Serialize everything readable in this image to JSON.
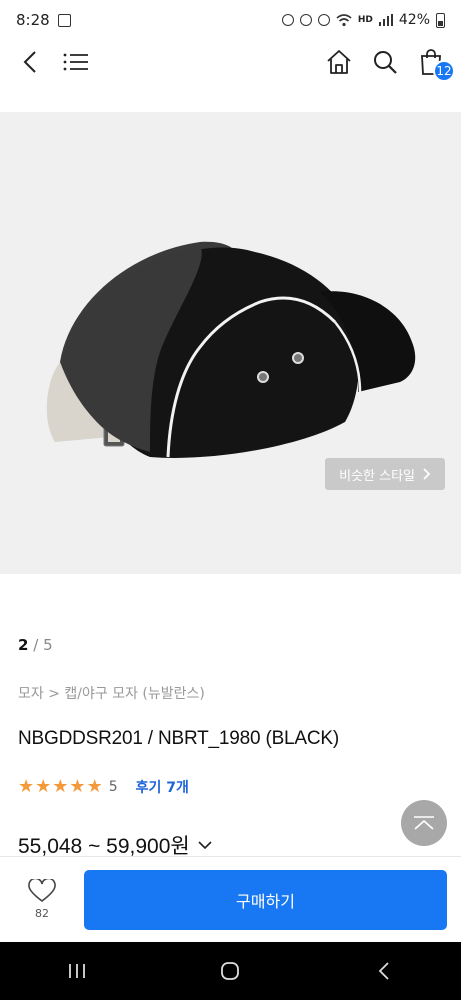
{
  "status": {
    "time": "8:28",
    "network": "HD",
    "battery": "42%"
  },
  "nav": {
    "cart_count": "12",
    "icons": [
      "back-icon",
      "menu-icon",
      "home-icon",
      "search-icon",
      "cart-icon"
    ]
  },
  "gallery": {
    "similar_style_label": "비슷한 스타일",
    "current": "2",
    "separator": "/",
    "total": "5"
  },
  "product": {
    "breadcrumb": "모자 > 캡/야구 모자 (뉴발란스)",
    "title": "NBGDDSR201 / NBRT_1980 (BLACK)",
    "rating": 5,
    "rating_count": "5",
    "review_label": "후기 7개",
    "price": "55,048 ~ 59,900원"
  },
  "actions": {
    "like_count": "82",
    "buy_label": "구매하기"
  },
  "colors": {
    "accent": "#1877f2",
    "star": "#f39a3a",
    "review": "#1e64d8"
  }
}
